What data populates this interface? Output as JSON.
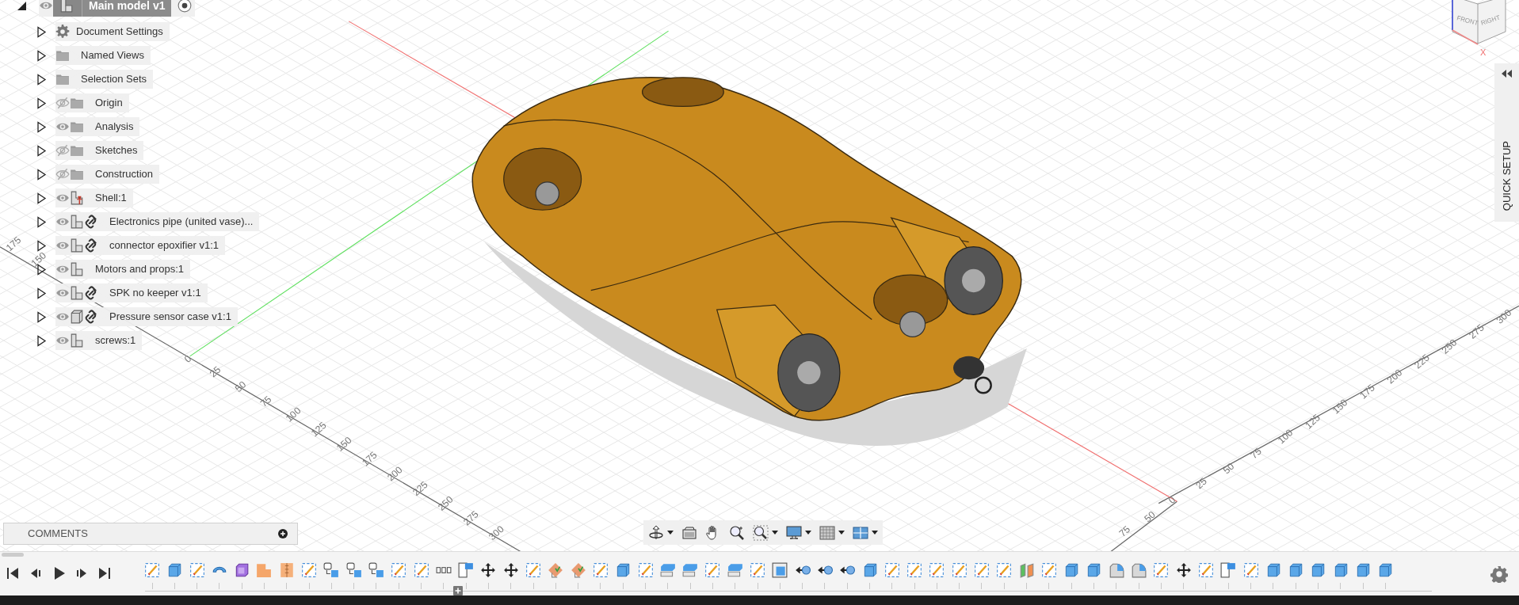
{
  "browser": {
    "root": {
      "label": "Main model v1",
      "visible": true,
      "expanded": true,
      "active": true
    },
    "items": [
      {
        "label": "Document Settings",
        "kind": "settings",
        "expanded": false
      },
      {
        "label": "Named Views",
        "kind": "folder",
        "expanded": false
      },
      {
        "label": "Selection Sets",
        "kind": "folder",
        "expanded": false
      },
      {
        "label": "Origin",
        "kind": "folder",
        "visible": false,
        "expanded": false
      },
      {
        "label": "Analysis",
        "kind": "folder",
        "visible": true,
        "expanded": false
      },
      {
        "label": "Sketches",
        "kind": "folder",
        "visible": false,
        "expanded": false
      },
      {
        "label": "Construction",
        "kind": "folder",
        "visible": false,
        "expanded": false
      },
      {
        "label": "Shell:1",
        "kind": "pinned-component",
        "visible": true,
        "expanded": false
      },
      {
        "label": "Electronics pipe (united vase)...",
        "kind": "component",
        "visible": true,
        "linked": true,
        "expanded": false
      },
      {
        "label": "connector epoxifier v1:1",
        "kind": "component",
        "visible": true,
        "linked": true,
        "expanded": false
      },
      {
        "label": "Motors and props:1",
        "kind": "component",
        "visible": true,
        "linked": false,
        "expanded": false
      },
      {
        "label": "SPK no keeper v1:1",
        "kind": "component",
        "visible": true,
        "linked": true,
        "expanded": false
      },
      {
        "label": "Pressure sensor case v1:1",
        "kind": "body",
        "visible": true,
        "linked": true,
        "expanded": false
      },
      {
        "label": "screws:1",
        "kind": "component",
        "visible": true,
        "linked": false,
        "expanded": false
      }
    ]
  },
  "viewport": {
    "left_ruler": [
      "0",
      "25",
      "50",
      "75",
      "100",
      "125",
      "150",
      "175",
      "200",
      "225",
      "250",
      "275",
      "300"
    ],
    "right_ruler": [
      "0",
      "25",
      "50",
      "75",
      "100",
      "125",
      "150",
      "175",
      "200",
      "225",
      "250",
      "275",
      "300"
    ],
    "back_ruler": [
      "150",
      "175"
    ],
    "front_ruler": [
      "50",
      "75"
    ]
  },
  "view_cube": {
    "faces": [
      "FRONT",
      "RIGHT"
    ],
    "axis": "X"
  },
  "quick_setup": {
    "label": "QUICK SETUP"
  },
  "comments": {
    "label": "COMMENTS"
  }
}
